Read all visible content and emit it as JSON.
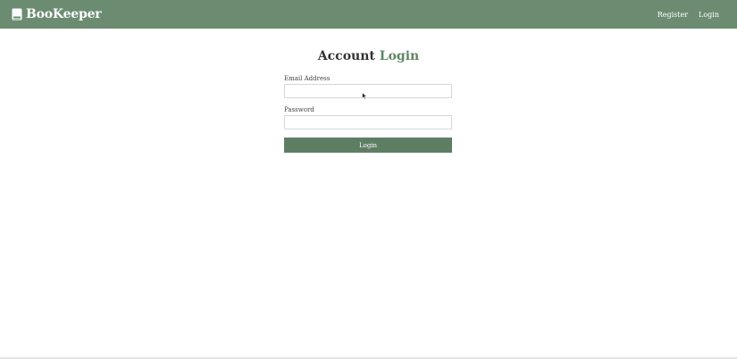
{
  "navbar": {
    "brand": "BooKeeper",
    "brand_icon": "book-icon",
    "links": {
      "register": "Register",
      "login": "Login"
    },
    "background_color": "#6b8c71"
  },
  "page": {
    "title_prefix": "Account",
    "title_accent": "Login",
    "accent_color": "#5e8662"
  },
  "form": {
    "email_label": "Email Address",
    "email_value": "",
    "password_label": "Password",
    "password_value": "",
    "submit_label": "Login",
    "button_color": "#5e7e64"
  }
}
